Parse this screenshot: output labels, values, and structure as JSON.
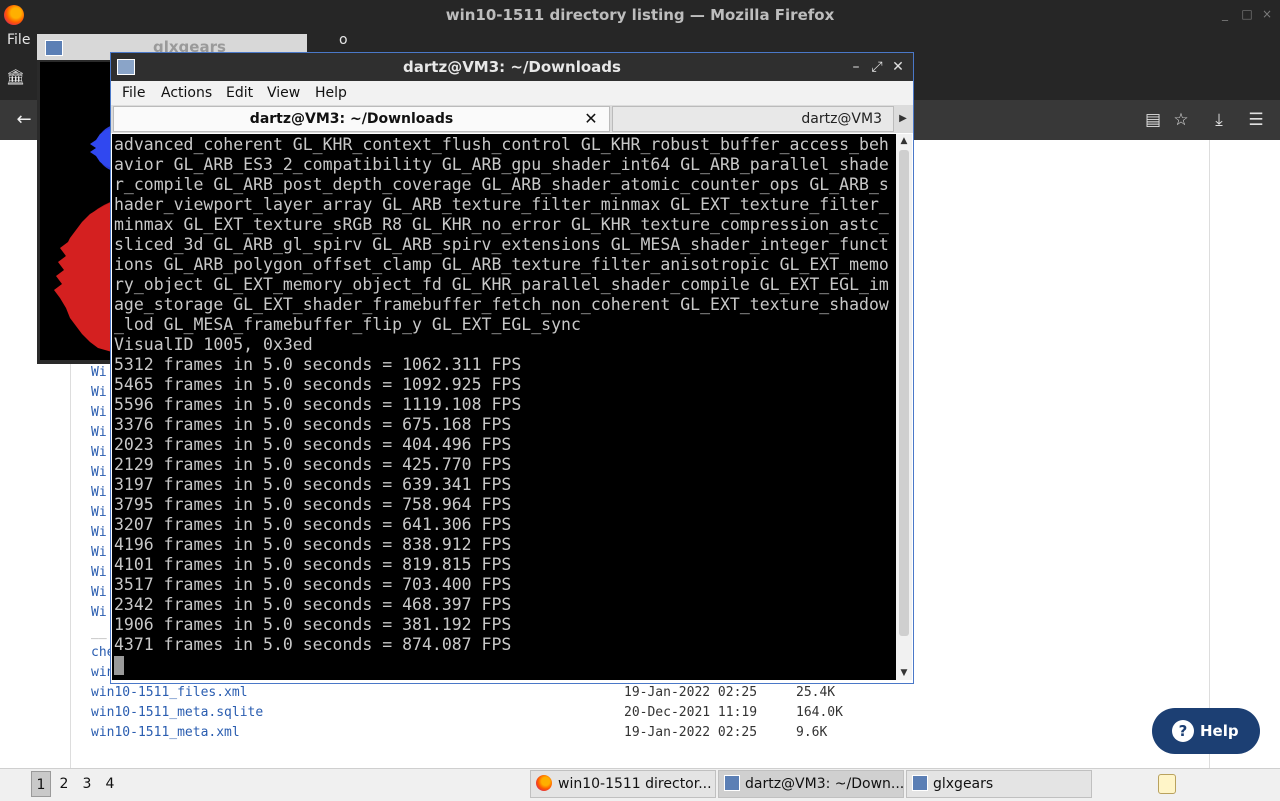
{
  "firefox": {
    "window_title": "win10-1511 directory listing — Mozilla Firefox",
    "menu_file": "File",
    "menu_partial": "o"
  },
  "page": {
    "left_links": [
      "Wi",
      "Wi",
      "Wi",
      "Wi",
      "Wi",
      "Wi",
      "Wi",
      "Wi",
      "Wi",
      "Wi",
      "Wi",
      "Wi",
      "Wi"
    ],
    "separator": "__",
    "partial_link_1": "che",
    "partial_link_2": "win",
    "files": [
      {
        "name": "win10-1511_files.xml",
        "date": "19-Jan-2022 02:25",
        "size": "25.4K"
      },
      {
        "name": "win10-1511_meta.sqlite",
        "date": "20-Dec-2021 11:19",
        "size": "164.0K"
      },
      {
        "name": "win10-1511_meta.xml",
        "date": "19-Jan-2022 02:25",
        "size": "9.6K"
      }
    ],
    "help_label": "Help"
  },
  "glxgears": {
    "title": "glxgears"
  },
  "terminal": {
    "title": "dartz@VM3: ~/Downloads",
    "menu": [
      "File",
      "Actions",
      "Edit",
      "View",
      "Help"
    ],
    "tab1": "dartz@VM3: ~/Downloads",
    "tab2": "dartz@VM3",
    "output": "advanced_coherent GL_KHR_context_flush_control GL_KHR_robust_buffer_access_behavior GL_ARB_ES3_2_compatibility GL_ARB_gpu_shader_int64 GL_ARB_parallel_shader_compile GL_ARB_post_depth_coverage GL_ARB_shader_atomic_counter_ops GL_ARB_shader_viewport_layer_array GL_ARB_texture_filter_minmax GL_EXT_texture_filter_minmax GL_EXT_texture_sRGB_R8 GL_KHR_no_error GL_KHR_texture_compression_astc_sliced_3d GL_ARB_gl_spirv GL_ARB_spirv_extensions GL_MESA_shader_integer_functions GL_ARB_polygon_offset_clamp GL_ARB_texture_filter_anisotropic GL_EXT_memory_object GL_EXT_memory_object_fd GL_KHR_parallel_shader_compile GL_EXT_EGL_image_storage GL_EXT_shader_framebuffer_fetch_non_coherent GL_EXT_texture_shadow_lod GL_MESA_framebuffer_flip_y GL_EXT_EGL_sync\nVisualID 1005, 0x3ed\n5312 frames in 5.0 seconds = 1062.311 FPS\n5465 frames in 5.0 seconds = 1092.925 FPS\n5596 frames in 5.0 seconds = 1119.108 FPS\n3376 frames in 5.0 seconds = 675.168 FPS\n2023 frames in 5.0 seconds = 404.496 FPS\n2129 frames in 5.0 seconds = 425.770 FPS\n3197 frames in 5.0 seconds = 639.341 FPS\n3795 frames in 5.0 seconds = 758.964 FPS\n3207 frames in 5.0 seconds = 641.306 FPS\n4196 frames in 5.0 seconds = 838.912 FPS\n4101 frames in 5.0 seconds = 819.815 FPS\n3517 frames in 5.0 seconds = 703.400 FPS\n2342 frames in 5.0 seconds = 468.397 FPS\n1906 frames in 5.0 seconds = 381.192 FPS\n4371 frames in 5.0 seconds = 874.087 FPS"
  },
  "taskbar": {
    "workspaces": [
      "1",
      "2",
      "3",
      "4"
    ],
    "tasks": [
      {
        "label": "win10-1511 director..."
      },
      {
        "label": "dartz@VM3: ~/Down..."
      },
      {
        "label": "glxgears"
      }
    ]
  },
  "colors": {
    "link": "#2a5db0",
    "help_button": "#1c3f73",
    "terminal_bg": "#000000",
    "terminal_fg": "#c8c8c8"
  }
}
